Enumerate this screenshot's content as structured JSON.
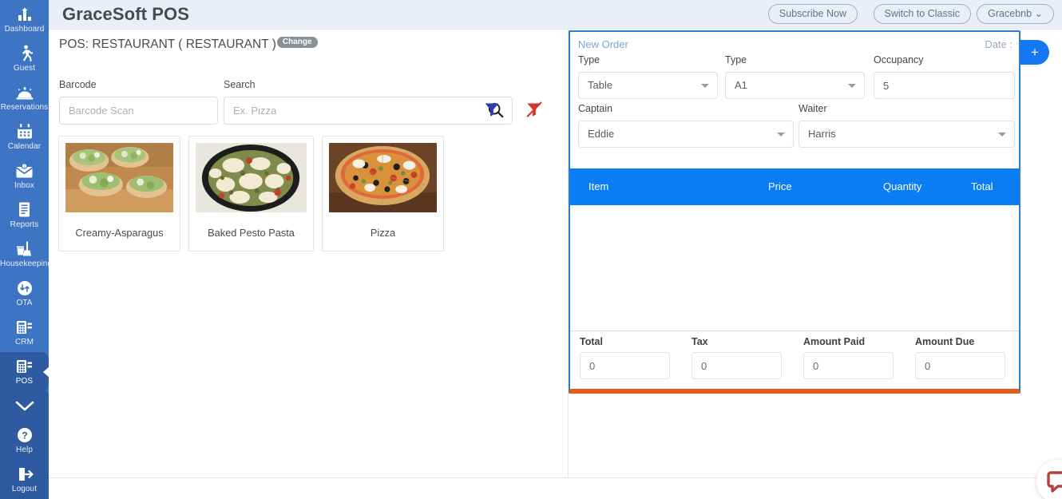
{
  "header": {
    "app_title": "GraceSoft POS",
    "subscribe_label": "Subscribe Now",
    "switch_classic_label": "Switch to Classic",
    "account_label": "Gracebnb ⌄"
  },
  "sidebar": {
    "items": [
      {
        "label": "Dashboard",
        "icon": "dashboard-icon",
        "active": false
      },
      {
        "label": "Guest",
        "icon": "guest-icon",
        "active": false
      },
      {
        "label": "Reservations",
        "icon": "reservations-icon",
        "active": false
      },
      {
        "label": "Calendar",
        "icon": "calendar-icon",
        "active": false
      },
      {
        "label": "Inbox",
        "icon": "inbox-icon",
        "active": false
      },
      {
        "label": "Reports",
        "icon": "reports-icon",
        "active": false
      },
      {
        "label": "Housekeeping",
        "icon": "housekeeping-icon",
        "active": false
      },
      {
        "label": "OTA",
        "icon": "ota-icon",
        "active": false
      },
      {
        "label": "CRM",
        "icon": "crm-icon",
        "active": false
      },
      {
        "label": "POS",
        "icon": "pos-icon",
        "active": true
      }
    ],
    "expand_icon": "chevron-down-icon",
    "bottom_items": [
      {
        "label": "Help",
        "icon": "help-icon"
      },
      {
        "label": "Logout",
        "icon": "logout-icon"
      }
    ]
  },
  "pos": {
    "title": "POS: RESTAURANT ( RESTAURANT )",
    "change_badge": "Change",
    "barcode_label": "Barcode",
    "barcode_placeholder": "Barcode Scan",
    "barcode_value": "",
    "search_label": "Search",
    "search_placeholder": "Ex. Pizza",
    "search_value": "",
    "search_icon": "search-icon",
    "filter_icon": "filter-icon",
    "filter_clear_icon": "filter-clear-icon"
  },
  "products": [
    {
      "name": "Creamy-Asparagus"
    },
    {
      "name": "Baked Pesto Pasta"
    },
    {
      "name": "Pizza"
    }
  ],
  "order": {
    "panel_title": "New Order",
    "date_label": "Date :",
    "type1_label": "Type",
    "type1_value": "Table",
    "type2_label": "Type",
    "type2_value": "A1",
    "occupancy_label": "Occupancy",
    "occupancy_value": "5",
    "captain_label": "Captain",
    "captain_value": "Eddie",
    "waiter_label": "Waiter",
    "waiter_value": "Harris",
    "columns": {
      "item": "Item",
      "price": "Price",
      "quantity": "Quantity",
      "total": "Total"
    },
    "rows": [],
    "totals": {
      "total_label": "Total",
      "total_value": "0",
      "tax_label": "Tax",
      "tax_value": "0",
      "paid_label": "Amount Paid",
      "paid_value": "0",
      "due_label": "Amount Due",
      "due_value": "0"
    },
    "add_button_label": "+"
  },
  "chat": {
    "icon": "chat-bubble-icon"
  },
  "colors": {
    "sidebar": "#3d74c4",
    "sidebar_active": "#2d5aa0",
    "header_bg": "#eaeff7",
    "accent_blue": "#0a7cf4",
    "panel_border": "#2b7dd4",
    "panel_bottom": "#e85a19",
    "filter_blue": "#2b3fb0",
    "filter_red": "#d9342b",
    "chat_red": "#b5403c"
  }
}
